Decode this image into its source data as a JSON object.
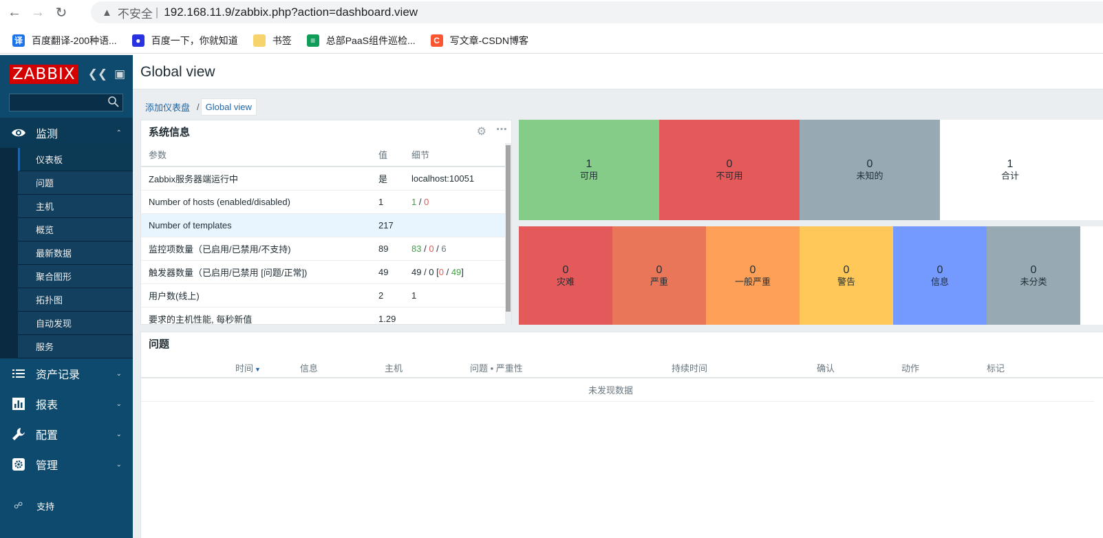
{
  "browser": {
    "url_warning": "不安全",
    "url_separator": "|",
    "url": "192.168.11.9/zabbix.php?action=dashboard.view",
    "bookmarks": [
      {
        "label": "百度翻译-200种语...",
        "icon": "translate-icon",
        "color": "#1a73e8",
        "glyph": "译"
      },
      {
        "label": "百度一下，你就知道",
        "icon": "baidu-paw-icon",
        "color": "#2932e1",
        "glyph": "●"
      },
      {
        "label": "书签",
        "icon": "folder-icon",
        "color": "#f6d36b",
        "glyph": ""
      },
      {
        "label": "总部PaaS组件巡检...",
        "icon": "sheets-icon",
        "color": "#0f9d58",
        "glyph": "≡"
      },
      {
        "label": "写文章-CSDN博客",
        "icon": "csdn-icon",
        "color": "#fc5531",
        "glyph": "C"
      }
    ]
  },
  "sidebar": {
    "logo": "ZABBIX",
    "search_placeholder": "",
    "groups": [
      {
        "label": "监测",
        "icon": "eye-icon",
        "open": true,
        "items": [
          {
            "label": "仪表板",
            "active": true
          },
          {
            "label": "问题"
          },
          {
            "label": "主机"
          },
          {
            "label": "概览"
          },
          {
            "label": "最新数据"
          },
          {
            "label": "聚合图形"
          },
          {
            "label": "拓扑图"
          },
          {
            "label": "自动发现"
          },
          {
            "label": "服务"
          }
        ]
      },
      {
        "label": "资产记录",
        "icon": "list-icon"
      },
      {
        "label": "报表",
        "icon": "bar-chart-icon"
      },
      {
        "label": "配置",
        "icon": "wrench-icon"
      },
      {
        "label": "管理",
        "icon": "gear-icon"
      }
    ],
    "support": "支持"
  },
  "header": {
    "title": "Global view"
  },
  "breadcrumb": {
    "parent": "添加仪表盘",
    "separator": "/",
    "current": "Global view"
  },
  "system_info": {
    "title": "系统信息",
    "columns": [
      "参数",
      "值",
      "细节"
    ],
    "rows": [
      {
        "param": "Zabbix服务器端运行中",
        "value": "是",
        "detail": "localhost:10051"
      },
      {
        "param": "Number of hosts (enabled/disabled)",
        "value": "1",
        "d1": "1",
        "s1": " / ",
        "d2": "0"
      },
      {
        "param": "Number of templates",
        "value": "217",
        "detail": ""
      },
      {
        "param": "监控项数量（已启用/已禁用/不支持)",
        "value": "89",
        "d1": "83",
        "s1": " / ",
        "d2": "0",
        "s2": " / ",
        "d3": "6"
      },
      {
        "param": "触发器数量（已启用/已禁用 [问题/正常])",
        "value": "49",
        "d0": "49 / 0 [",
        "d1": "0",
        "s1": " / ",
        "d2": "49",
        "s2": "]"
      },
      {
        "param": "用户数(线上)",
        "value": "2",
        "d1": "1"
      },
      {
        "param": "要求的主机性能, 每秒新值",
        "value": "1.29",
        "detail": ""
      }
    ]
  },
  "host_availability": [
    {
      "num": "1",
      "label": "可用",
      "color": "#86cc89"
    },
    {
      "num": "0",
      "label": "不可用",
      "color": "#e45959"
    },
    {
      "num": "0",
      "label": "未知的",
      "color": "#97aab3"
    },
    {
      "num": "1",
      "label": "合计",
      "color": "#ffffff"
    }
  ],
  "problem_severity": [
    {
      "num": "0",
      "label": "灾难",
      "color": "#e45959"
    },
    {
      "num": "0",
      "label": "严重",
      "color": "#e97659"
    },
    {
      "num": "0",
      "label": "一般严重",
      "color": "#ffa059"
    },
    {
      "num": "0",
      "label": "警告",
      "color": "#ffc859"
    },
    {
      "num": "0",
      "label": "信息",
      "color": "#7499ff"
    },
    {
      "num": "0",
      "label": "未分类",
      "color": "#97aab3"
    }
  ],
  "problems": {
    "title": "问题",
    "columns": [
      "时间",
      "信息",
      "主机",
      "问题 • 严重性",
      "持续时间",
      "确认",
      "动作",
      "标记"
    ],
    "empty": "未发现数据"
  }
}
